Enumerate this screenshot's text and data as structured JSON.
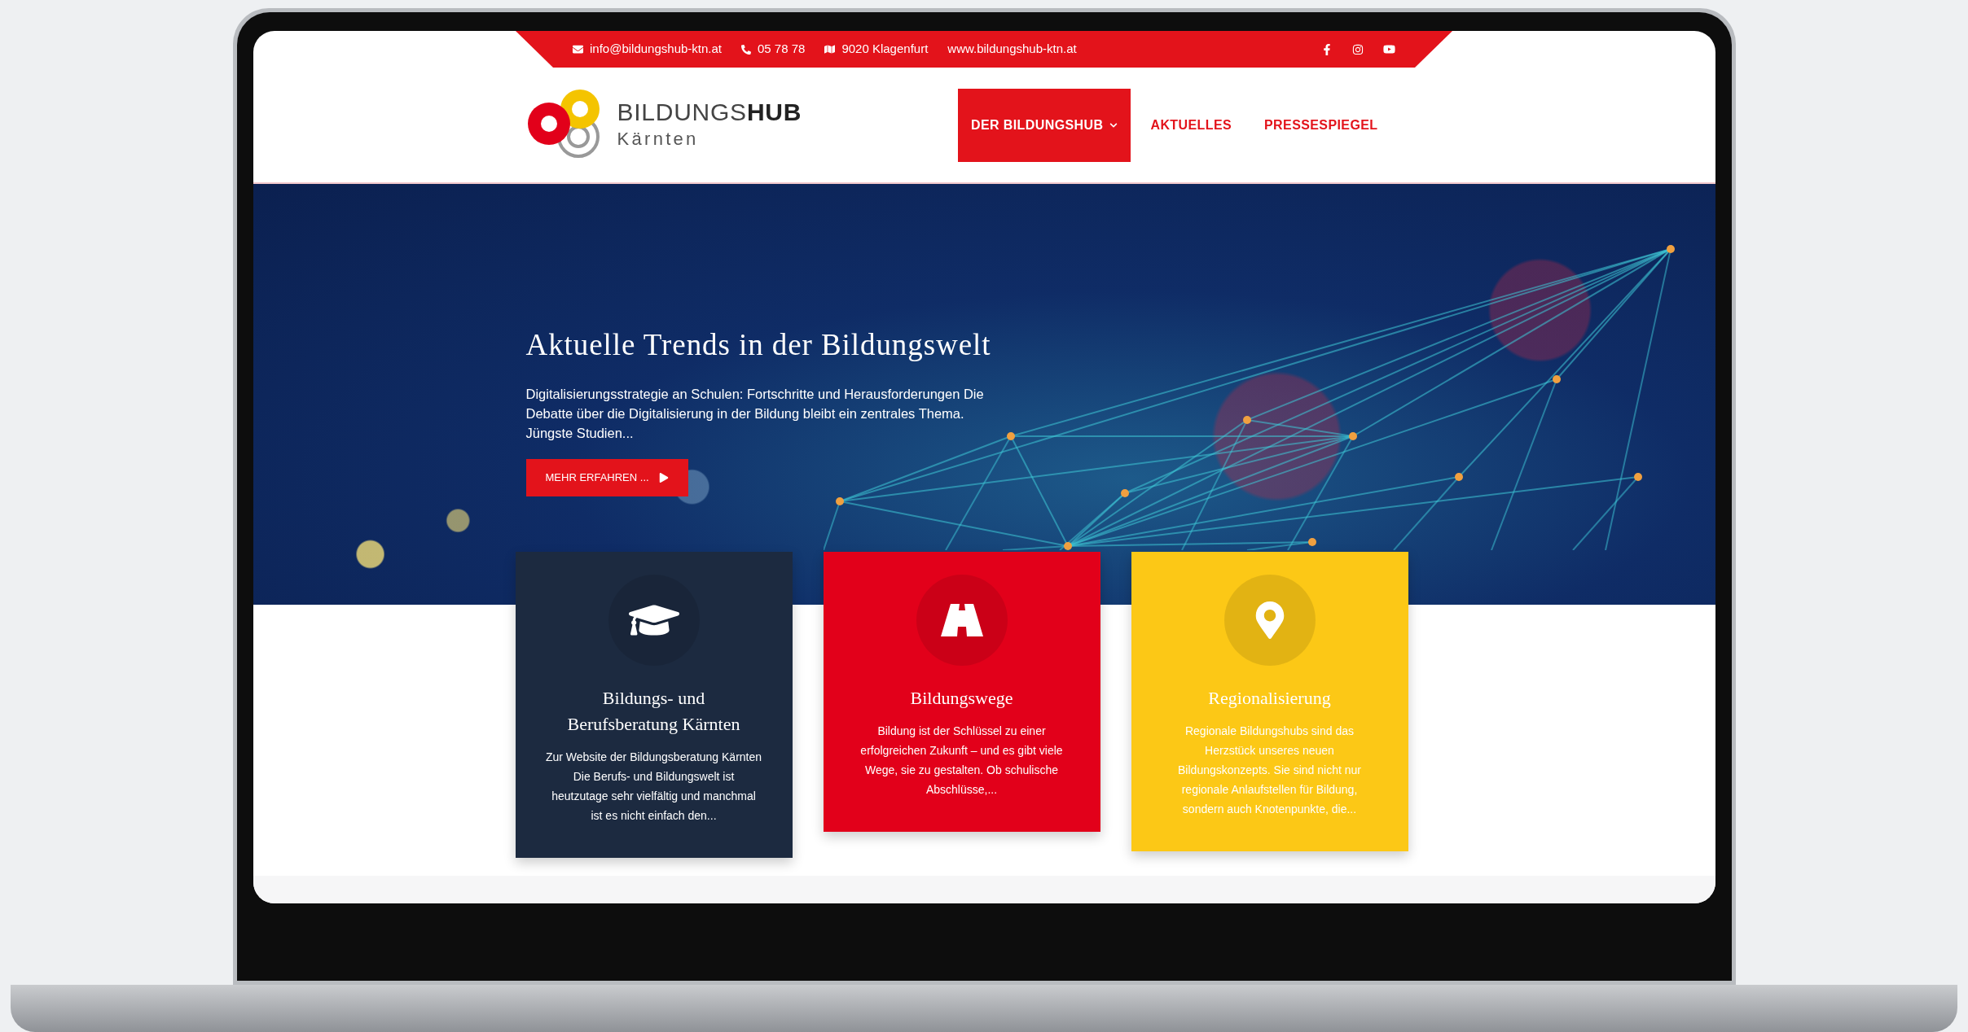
{
  "topbar": {
    "email": "info@bildungshub-ktn.at",
    "phone": "05 78 78",
    "address": "9020 Klagenfurt",
    "website": "www.bildungshub-ktn.at"
  },
  "social": [
    {
      "kind": "facebook"
    },
    {
      "kind": "instagram"
    },
    {
      "kind": "youtube"
    }
  ],
  "logo": {
    "name_light": "BILDUNGS",
    "name_bold": "HUB",
    "region": "Kärnten"
  },
  "nav": [
    {
      "label": "DER BILDUNGSHUB",
      "selected": true,
      "dropdown": true
    },
    {
      "label": "AKTUELLES",
      "selected": false,
      "dropdown": false
    },
    {
      "label": "PRESSESPIEGEL",
      "selected": false,
      "dropdown": false
    }
  ],
  "hero": {
    "title": "Aktuelle Trends in der Bildungswelt",
    "text": "Digitalisierungsstrategie an Schulen: Fortschritte und Herausforderungen Die Debatte über die Digitalisierung in der Bildung bleibt ein zentrales Thema. Jüngste Studien...",
    "button": "MEHR ERFAHREN ..."
  },
  "cards": [
    {
      "kind": "graduation",
      "color": "#1c2a40",
      "title": "Bildungs- und Berufsberatung Kärnten",
      "text": "Zur Website der Bildungsberatung Kärnten Die Berufs- und Bildungswelt ist heutzutage sehr vielfältig und manchmal ist es nicht einfach den..."
    },
    {
      "kind": "road",
      "color": "#e2001a",
      "title": "Bildungswege",
      "text": "Bildung ist der Schlüssel zu einer erfolgreichen Zukunft – und es gibt viele Wege, sie zu gestalten. Ob schulische Abschlüsse,..."
    },
    {
      "kind": "pin",
      "color": "#fcc816",
      "title": "Regionalisierung",
      "text": "Regionale Bildungshubs sind das Herzstück unseres neuen Bildungskonzepts. Sie sind nicht nur regionale Anlaufstellen für Bildung, sondern auch Knotenpunkte, die..."
    }
  ]
}
